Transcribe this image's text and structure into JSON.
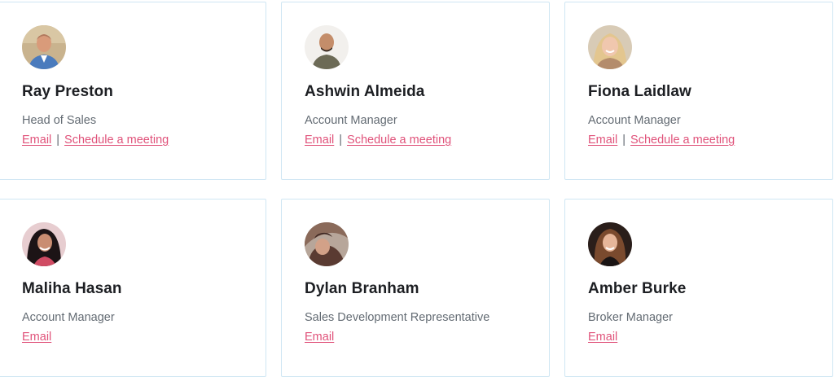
{
  "colors": {
    "card_border": "#cfe6f3",
    "name_text": "#1d1f23",
    "title_text": "#636b73",
    "link": "#e0527a"
  },
  "link_separator": "|",
  "cards": [
    {
      "name": "Ray Preston",
      "title": "Head of Sales",
      "email_label": "Email",
      "meeting_label": "Schedule a meeting",
      "avatar_icon": "person-photo-icon"
    },
    {
      "name": "Ashwin Almeida",
      "title": "Account Manager",
      "email_label": "Email",
      "meeting_label": "Schedule a meeting",
      "avatar_icon": "person-photo-icon"
    },
    {
      "name": "Fiona Laidlaw",
      "title": "Account Manager",
      "email_label": "Email",
      "meeting_label": "Schedule a meeting",
      "avatar_icon": "person-photo-icon"
    },
    {
      "name": "Maliha Hasan",
      "title": "Account Manager",
      "email_label": "Email",
      "avatar_icon": "person-photo-icon"
    },
    {
      "name": "Dylan Branham",
      "title": "Sales Development Representative",
      "email_label": "Email",
      "avatar_icon": "person-photo-icon"
    },
    {
      "name": "Amber Burke",
      "title": "Broker Manager",
      "email_label": "Email",
      "avatar_icon": "person-photo-icon"
    }
  ]
}
